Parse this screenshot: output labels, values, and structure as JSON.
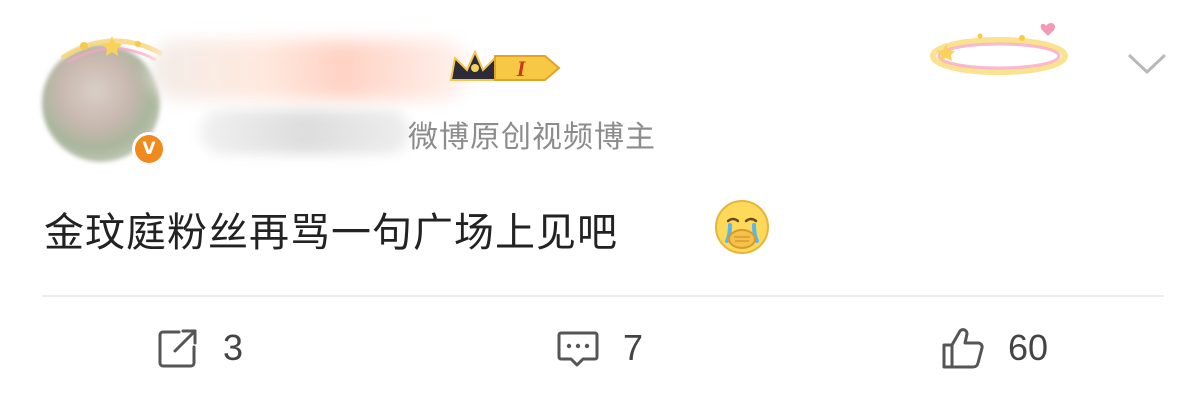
{
  "post": {
    "author": {
      "verification_label": "微博原创视频博主",
      "level_badge": "I",
      "verified_mark": "V"
    },
    "content": "金玟庭粉丝再骂一句广场上见吧",
    "emoji": "crying-covering-mouth-emoji",
    "actions": {
      "repost_count": "3",
      "comment_count": "7",
      "like_count": "60"
    }
  },
  "colors": {
    "verified_badge": "#f08a1d",
    "text_primary": "#222222",
    "text_secondary": "#8c8c8c",
    "icon": "#555555"
  }
}
